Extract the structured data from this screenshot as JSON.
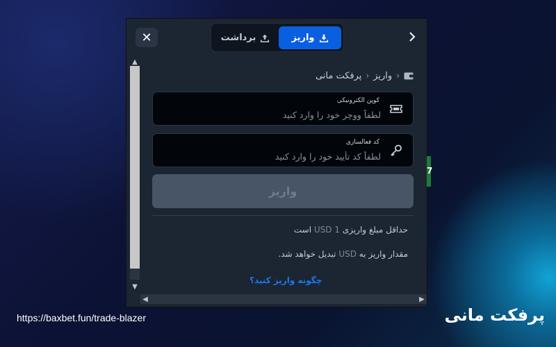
{
  "header": {
    "tabs": [
      {
        "label": "واریز",
        "active": true,
        "icon": "download-icon"
      },
      {
        "label": "برداشت",
        "active": false,
        "icon": "upload-icon"
      }
    ],
    "close_icon": "close-icon",
    "back_icon": "chevron-right-icon"
  },
  "breadcrumb": {
    "icon": "wallet-icon",
    "items": [
      "واریز",
      "پرفکت مانی"
    ]
  },
  "form": {
    "voucher": {
      "label": "کوپن الکترونیکی",
      "value": "",
      "placeholder": "لطفاً ووچر خود را وارد کنید",
      "icon": "ticket-icon"
    },
    "activation": {
      "label": "کد فعالسازی",
      "value": "",
      "placeholder": "لطفاً کد تأیید خود را وارد کنید",
      "icon": "key-icon"
    },
    "submit_label": "واریز"
  },
  "info": {
    "min_prefix": "حداقل مبلغ واریزی",
    "min_amount": "1 USD",
    "min_suffix": "است",
    "convert_prefix": "مقدار واریز به",
    "convert_currency": "USD",
    "convert_suffix": "تبدیل خواهد شد."
  },
  "help_link": "چگونه واریز کنید؟",
  "side_digit": "7",
  "footer": {
    "url": "https://baxbet.fun/trade-blazer",
    "brand": "پرفکت مانی"
  },
  "colors": {
    "accent": "#0a5fe0",
    "link": "#1a78f2",
    "panel_bg": "#1c2532",
    "input_bg": "#02050a",
    "button_disabled": "#485567"
  }
}
